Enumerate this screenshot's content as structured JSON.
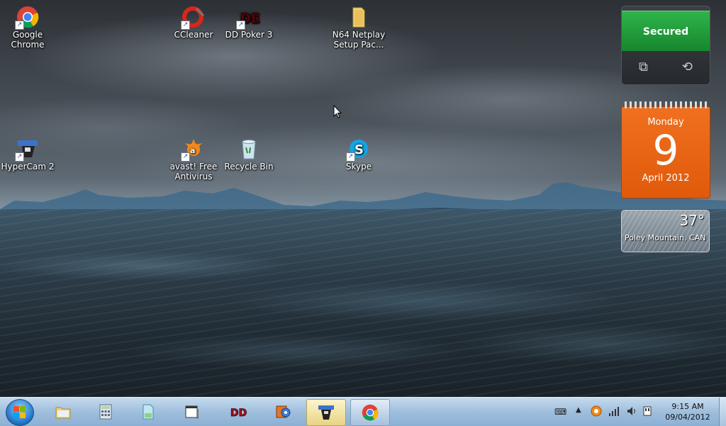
{
  "desktop": {
    "icons": [
      {
        "label": "Google\nChrome",
        "icon": "chrome-icon"
      },
      {
        "label": "CCleaner",
        "icon": "ccleaner-icon"
      },
      {
        "label": "DD Poker 3",
        "icon": "dd-poker-icon"
      },
      {
        "label": "N64 Netplay\nSetup Pac...",
        "icon": "folder-icon"
      },
      {
        "label": "HyperCam 2",
        "icon": "hypercam-icon"
      },
      {
        "label": "avast! Free\nAntivirus",
        "icon": "avast-icon"
      },
      {
        "label": "Recycle Bin",
        "icon": "recycle-bin-icon"
      },
      {
        "label": "Skype",
        "icon": "skype-icon"
      }
    ]
  },
  "gadgets": {
    "security": {
      "status": "Secured",
      "color": "#22a23c"
    },
    "calendar": {
      "day": "Monday",
      "date": "9",
      "month": "April 2012",
      "color": "#ec6614"
    },
    "weather": {
      "temperature": "37°",
      "location": "Poley Mountain, CAN"
    }
  },
  "taskbar": {
    "pinned": [
      {
        "name": "windows-explorer",
        "icon": "folder-icon"
      },
      {
        "name": "calculator",
        "icon": "calculator-icon"
      },
      {
        "name": "file-manager",
        "icon": "file-manager-icon"
      },
      {
        "name": "window-app",
        "icon": "window-icon"
      },
      {
        "name": "dd-poker",
        "icon": "dd-poker-icon"
      },
      {
        "name": "media-app",
        "icon": "media-icon"
      },
      {
        "name": "hypercam",
        "icon": "hypercam-icon",
        "state": "active"
      },
      {
        "name": "chrome",
        "icon": "chrome-icon",
        "state": "running"
      }
    ],
    "clock": {
      "time": "9:15 AM",
      "date": "09/04/2012"
    }
  }
}
